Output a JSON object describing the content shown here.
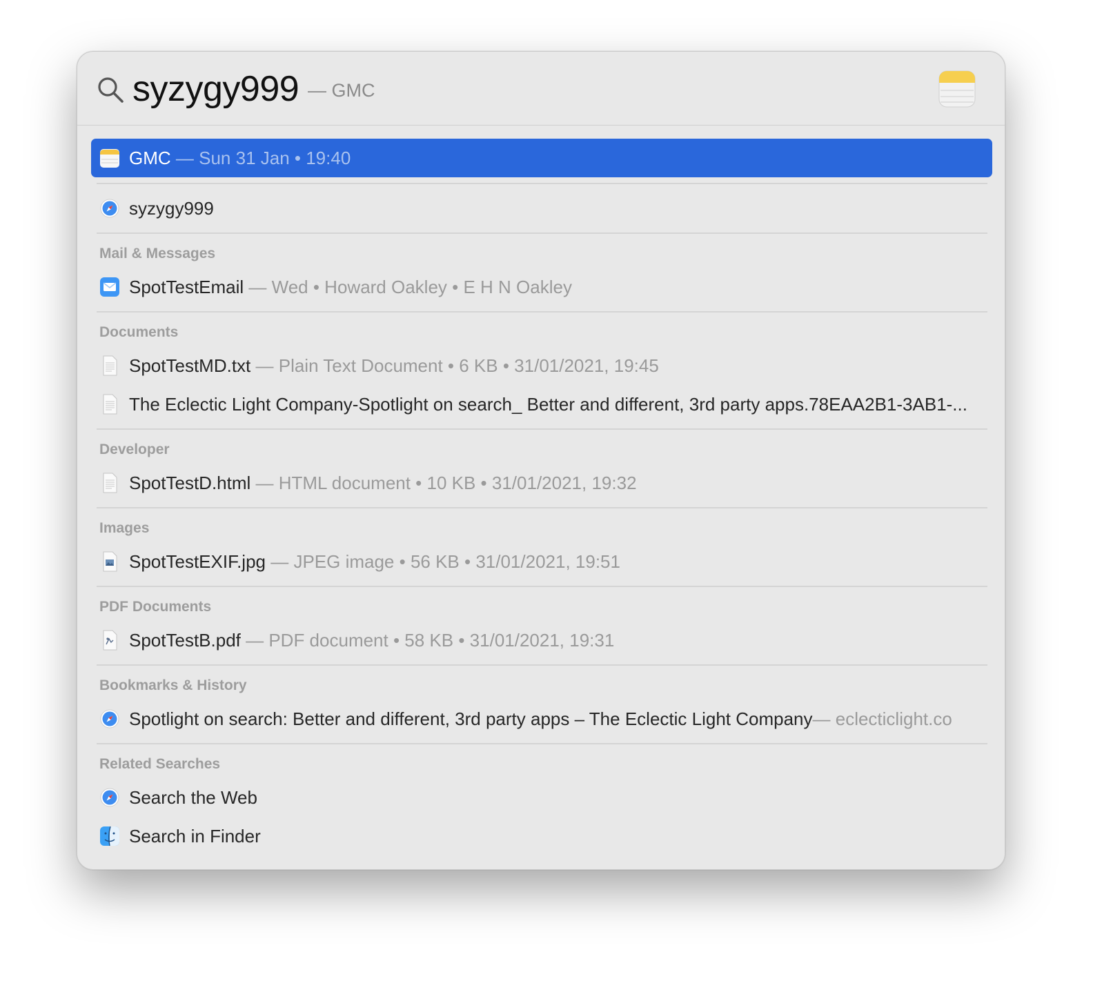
{
  "search": {
    "query": "syzygy999",
    "suffix": "— GMC"
  },
  "results": {
    "top_hit": {
      "title": "GMC",
      "meta": " — Sun 31 Jan • 19:40",
      "icon": "notes-icon"
    },
    "web_suggestion": {
      "title": "syzygy999",
      "icon": "safari-icon"
    },
    "sections": [
      {
        "header": "Mail & Messages",
        "items": [
          {
            "title": "SpotTestEmail",
            "meta": " — Wed • Howard Oakley • E H N Oakley",
            "icon": "mail-icon"
          }
        ]
      },
      {
        "header": "Documents",
        "items": [
          {
            "title": "SpotTestMD.txt",
            "meta": " — Plain Text Document • 6 KB • 31/01/2021, 19:45",
            "icon": "text-document-icon"
          },
          {
            "title": "The Eclectic Light Company-Spotlight on search_ Better and different, 3rd party apps.78EAA2B1-3AB1-...",
            "meta": "",
            "icon": "text-document-icon"
          }
        ]
      },
      {
        "header": "Developer",
        "items": [
          {
            "title": "SpotTestD.html",
            "meta": " — HTML document • 10 KB • 31/01/2021, 19:32",
            "icon": "html-document-icon"
          }
        ]
      },
      {
        "header": "Images",
        "items": [
          {
            "title": "SpotTestEXIF.jpg",
            "meta": " — JPEG image • 56 KB • 31/01/2021, 19:51",
            "icon": "jpeg-image-icon"
          }
        ]
      },
      {
        "header": "PDF Documents",
        "items": [
          {
            "title": "SpotTestB.pdf",
            "meta": " — PDF document • 58 KB • 31/01/2021, 19:31",
            "icon": "pdf-document-icon"
          }
        ]
      },
      {
        "header": "Bookmarks & History",
        "items": [
          {
            "title": "Spotlight on search: Better and different, 3rd party apps – The Eclectic Light Company",
            "meta": "— eclecticlight.co",
            "icon": "safari-icon"
          }
        ]
      },
      {
        "header": "Related Searches",
        "items": [
          {
            "title": "Search the Web",
            "meta": "",
            "icon": "safari-icon"
          },
          {
            "title": "Search in Finder",
            "meta": "",
            "icon": "finder-icon"
          }
        ]
      }
    ]
  },
  "colors": {
    "selection": "#2a67db",
    "panel_background": "#e8e8e8",
    "meta_text": "#9a9a9a"
  }
}
